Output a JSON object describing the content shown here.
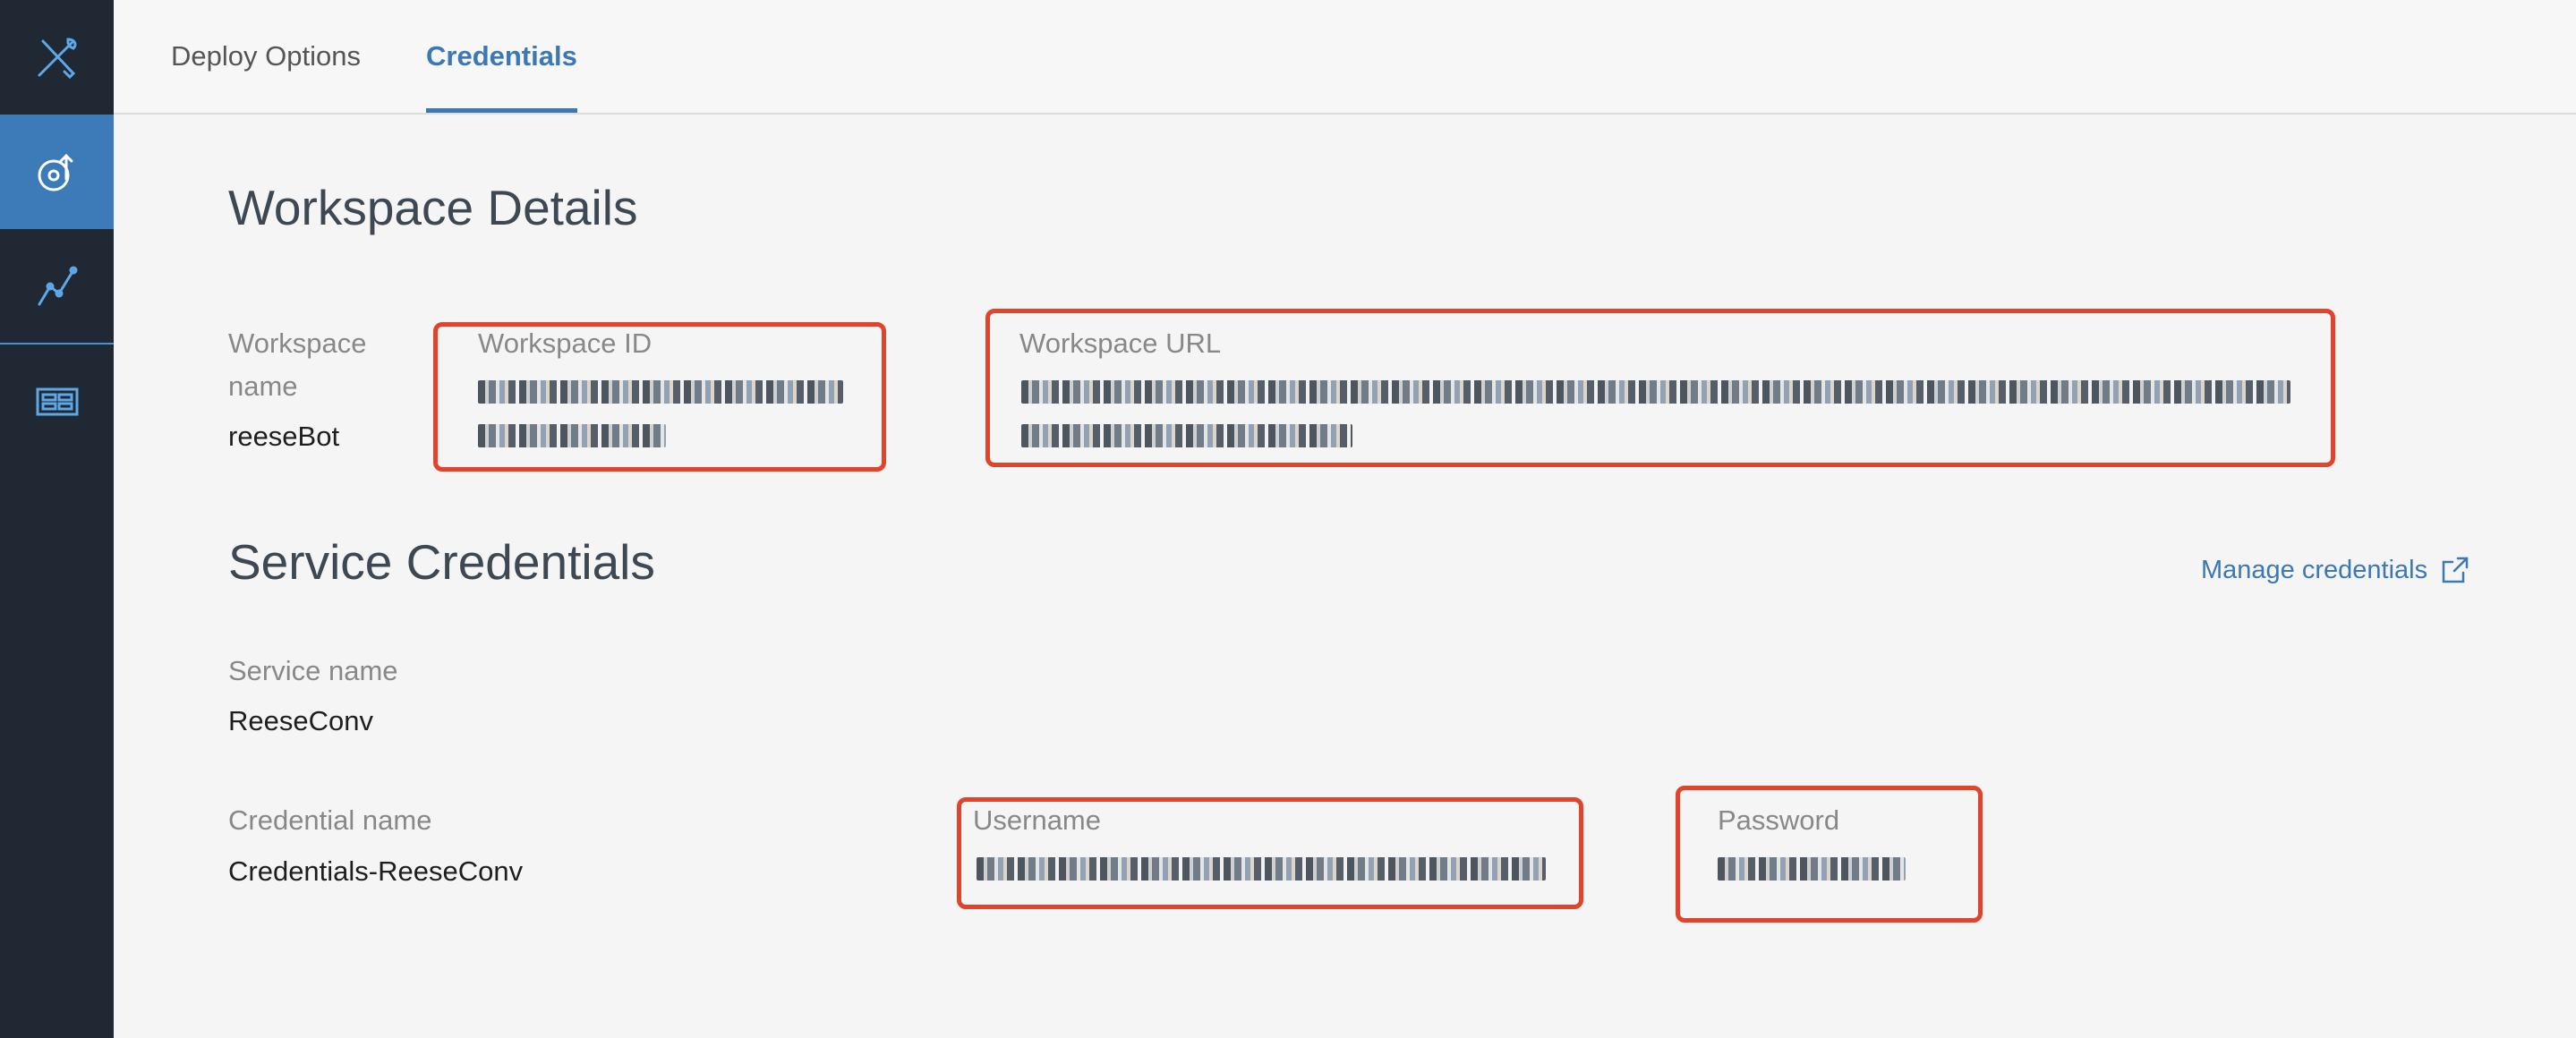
{
  "sidebar": {
    "items": [
      {
        "icon": "tools-icon"
      },
      {
        "icon": "deploy-icon"
      },
      {
        "icon": "analytics-icon"
      },
      {
        "icon": "workspace-icon"
      }
    ]
  },
  "tabs": [
    {
      "label": "Deploy Options"
    },
    {
      "label": "Credentials"
    }
  ],
  "workspace_details": {
    "title": "Workspace Details",
    "name_label_line1": "Workspace",
    "name_label_line2": "name",
    "name_value": "reeseBot",
    "id_label": "Workspace ID",
    "url_label": "Workspace URL"
  },
  "service_credentials": {
    "title": "Service Credentials",
    "manage_link": "Manage credentials",
    "service_name_label": "Service name",
    "service_name_value": "ReeseConv",
    "credential_name_label": "Credential name",
    "credential_name_value": "Credentials-ReeseConv",
    "username_label": "Username",
    "password_label": "Password"
  },
  "colors": {
    "accent": "#3c78b5",
    "highlight_box": "#e0452b",
    "sidebar_bg": "#1f2833",
    "sidebar_active": "#3d7ab8"
  }
}
